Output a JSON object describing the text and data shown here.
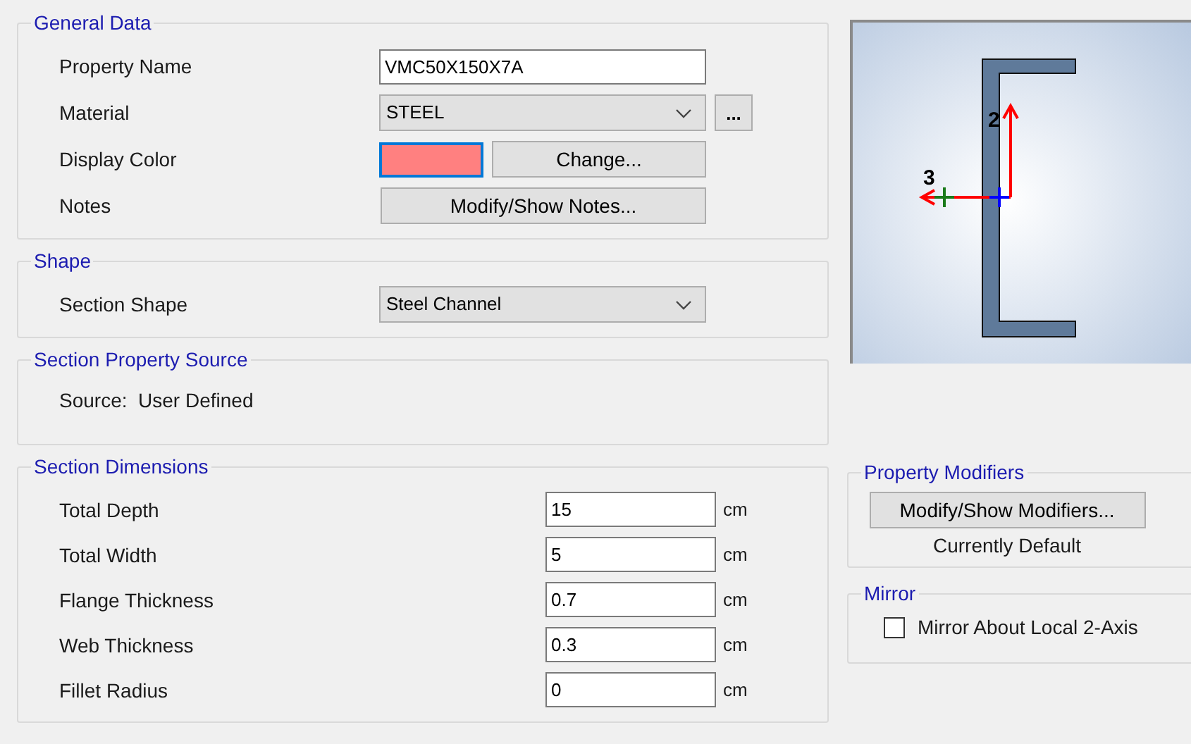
{
  "general_data": {
    "title": "General Data",
    "property_name": {
      "label": "Property Name",
      "value": "VMC50X150X7A"
    },
    "material": {
      "label": "Material",
      "value": "STEEL",
      "more_button": "..."
    },
    "display_color": {
      "label": "Display Color",
      "color": "#ff8080",
      "button": "Change..."
    },
    "notes": {
      "label": "Notes",
      "button": "Modify/Show Notes..."
    }
  },
  "shape": {
    "title": "Shape",
    "section_shape": {
      "label": "Section Shape",
      "value": "Steel Channel"
    }
  },
  "property_source": {
    "title": "Section Property Source",
    "source_label": "Source:",
    "source_value": "User Defined"
  },
  "dimensions": {
    "title": "Section Dimensions",
    "rows": [
      {
        "label": "Total Depth",
        "value": "15",
        "unit": "cm"
      },
      {
        "label": "Total Width",
        "value": "5",
        "unit": "cm"
      },
      {
        "label": "Flange Thickness",
        "value": "0.7",
        "unit": "cm"
      },
      {
        "label": "Web Thickness",
        "value": "0.3",
        "unit": "cm"
      },
      {
        "label": "Fillet Radius",
        "value": "0",
        "unit": "cm"
      }
    ]
  },
  "preview": {
    "axis_2_label": "2",
    "axis_3_label": "3"
  },
  "property_modifiers": {
    "title": "Property Modifiers",
    "button": "Modify/Show Modifiers...",
    "status": "Currently Default"
  },
  "mirror": {
    "title": "Mirror",
    "checkbox": {
      "label": "Mirror About Local 2-Axis",
      "checked": false
    }
  }
}
